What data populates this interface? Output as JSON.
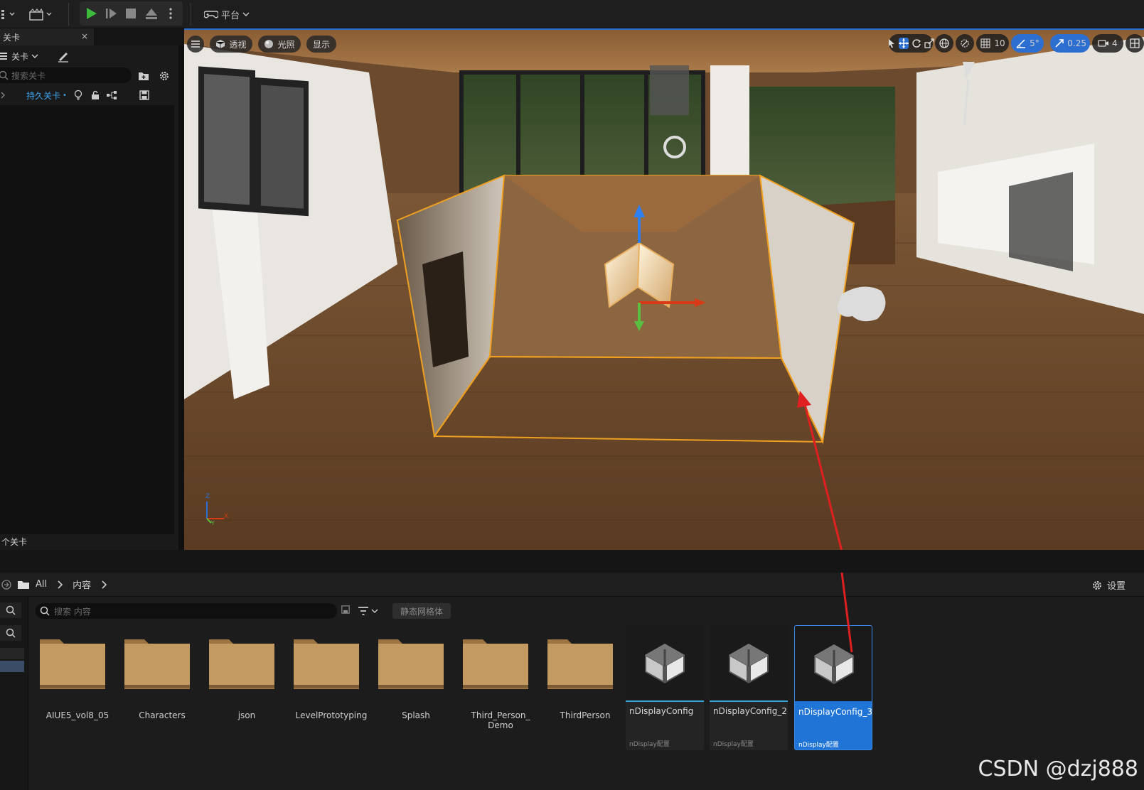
{
  "toolbar": {
    "platform_label": "平台"
  },
  "outliner": {
    "tab_title": "关卡",
    "close_glyph": "×",
    "levels_dropdown": "关卡",
    "search_placeholder": "搜索关卡",
    "level_row_name": "持久关卡",
    "level_row_dot": "•",
    "footer_text": "个关卡"
  },
  "viewport": {
    "perspective_label": "透视",
    "lit_label": "光照",
    "show_label": "显示",
    "grid_snap_value": "10",
    "rotate_snap_value": "5°",
    "scale_snap_value": "0.25",
    "camera_speed_value": "4",
    "axis_x": "X",
    "axis_z": "Z",
    "axis_y": "Y"
  },
  "content_browser": {
    "path": [
      "All",
      "内容"
    ],
    "settings_label": "设置",
    "search_placeholder": "搜索 内容",
    "filter_chip": "静态网格体",
    "folders": [
      {
        "name": "AIUE5_vol8_05"
      },
      {
        "name": "Characters"
      },
      {
        "name": "json"
      },
      {
        "name": "LevelPrototyping"
      },
      {
        "name": "Splash"
      },
      {
        "name": "Third_Person_ Demo"
      },
      {
        "name": "ThirdPerson"
      }
    ],
    "assets": [
      {
        "name": "nDisplayConfig",
        "type": "nDisplay配置",
        "selected": false
      },
      {
        "name": "nDisplayConfig_2",
        "type": "nDisplay配置",
        "selected": false
      },
      {
        "name": "nDisplayConfig_3",
        "type": "nDisplay配置",
        "selected": true
      }
    ]
  },
  "watermark": "CSDN @dzj888",
  "colors": {
    "accent_blue": "#2d6fd0",
    "selection_blue": "#1f74d6",
    "play_green": "#3dbb3d",
    "folder_tan": "#c39a62",
    "annotation_red": "#e02020",
    "selection_orange": "#f0a020"
  }
}
